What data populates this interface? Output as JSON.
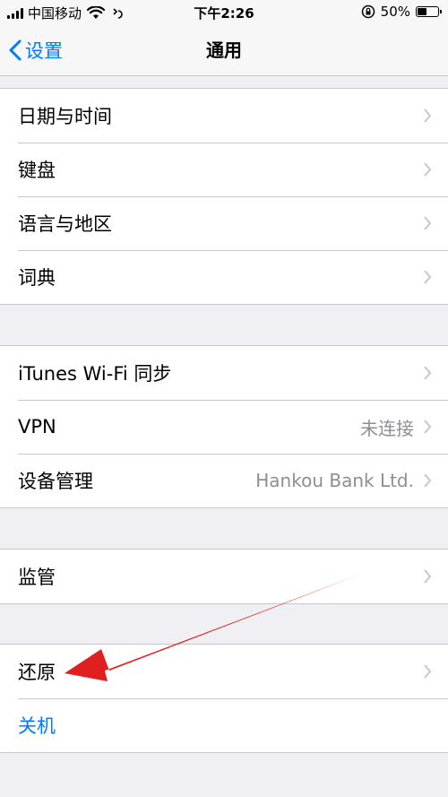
{
  "status_bar": {
    "carrier": "中国移动",
    "time": "下午2:26",
    "battery_percent_label": "50%",
    "battery_level": 0.5
  },
  "nav": {
    "back_label": "设置",
    "title": "通用"
  },
  "groups": [
    {
      "rows": [
        {
          "label": "日期与时间",
          "value": ""
        },
        {
          "label": "键盘",
          "value": ""
        },
        {
          "label": "语言与地区",
          "value": ""
        },
        {
          "label": "词典",
          "value": ""
        }
      ]
    },
    {
      "rows": [
        {
          "label": "iTunes Wi-Fi 同步",
          "value": ""
        },
        {
          "label": "VPN",
          "value": "未连接"
        },
        {
          "label": "设备管理",
          "value": "Hankou Bank Ltd."
        }
      ]
    },
    {
      "rows": [
        {
          "label": "监管",
          "value": ""
        }
      ]
    },
    {
      "rows": [
        {
          "label": "还原",
          "value": ""
        },
        {
          "label": "关机",
          "value": ""
        }
      ]
    }
  ],
  "colors": {
    "accent": "#007aff",
    "background": "#efeff4",
    "annotation_arrow": "#e02020"
  }
}
